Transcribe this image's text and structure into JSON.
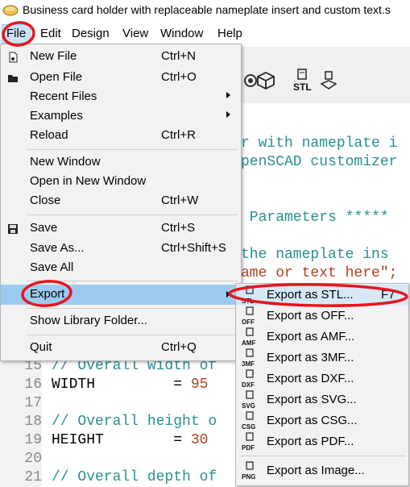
{
  "window": {
    "title": "Business card holder with replaceable nameplate insert and custom text.s"
  },
  "menubar": {
    "items": [
      "File",
      "Edit",
      "Design",
      "View",
      "Window",
      "Help"
    ]
  },
  "file_menu": {
    "items": [
      {
        "label": "New File",
        "shortcut": "Ctrl+N",
        "icon": "new-file-icon"
      },
      {
        "label": "Open File",
        "shortcut": "Ctrl+O",
        "icon": "open-folder-icon"
      },
      {
        "label": "Recent Files",
        "shortcut": "",
        "submenu": true
      },
      {
        "label": "Examples",
        "shortcut": "",
        "submenu": true
      },
      {
        "label": "Reload",
        "shortcut": "Ctrl+R"
      },
      {
        "label": "New Window",
        "shortcut": ""
      },
      {
        "label": "Open in New Window",
        "shortcut": ""
      },
      {
        "label": "Close",
        "shortcut": "Ctrl+W"
      },
      {
        "label": "Save",
        "shortcut": "Ctrl+S",
        "icon": "floppy-disk-icon"
      },
      {
        "label": "Save As...",
        "shortcut": "Ctrl+Shift+S"
      },
      {
        "label": "Save All",
        "shortcut": ""
      },
      {
        "label": "Export",
        "shortcut": "",
        "submenu": true,
        "highlighted": true
      },
      {
        "label": "Show Library Folder...",
        "shortcut": ""
      },
      {
        "label": "Quit",
        "shortcut": "Ctrl+Q"
      }
    ]
  },
  "export_menu": {
    "items": [
      {
        "label": "Export as STL...",
        "shortcut": "F7",
        "icon_text": "STL"
      },
      {
        "label": "Export as OFF...",
        "icon_text": "OFF"
      },
      {
        "label": "Export as AMF...",
        "icon_text": "AMF"
      },
      {
        "label": "Export as 3MF...",
        "icon_text": "3MF"
      },
      {
        "label": "Export as DXF...",
        "icon_text": "DXF"
      },
      {
        "label": "Export as SVG...",
        "icon_text": "SVG"
      },
      {
        "label": "Export as CSG...",
        "icon_text": "CSG"
      },
      {
        "label": "Export as PDF...",
        "icon_text": "PDF"
      },
      {
        "label": "Export as Image...",
        "icon_text": "PNG"
      }
    ]
  },
  "toolbar": {
    "stl_label": "STL"
  },
  "editor": {
    "fragments": [
      "r with nameplate i",
      "penSCAD customizer",
      " Parameters *****",
      "the nameplate ins",
      "ame or text here\";"
    ],
    "lines": [
      {
        "num": "15",
        "text": "// Overall width of"
      },
      {
        "num": "16",
        "key": "WIDTH",
        "eq": "         = ",
        "val": "95"
      },
      {
        "num": "17",
        "text": ""
      },
      {
        "num": "18",
        "text": "// Overall height o"
      },
      {
        "num": "19",
        "key": "HEIGHT",
        "eq": "        = ",
        "val": "30"
      },
      {
        "num": "20",
        "text": ""
      },
      {
        "num": "21",
        "text": "// Overall depth of"
      }
    ]
  },
  "colors": {
    "comment": "#2a8f8f",
    "string": "#b04020",
    "highlight": "#9ccbf2",
    "annotation": "#e8141c"
  }
}
